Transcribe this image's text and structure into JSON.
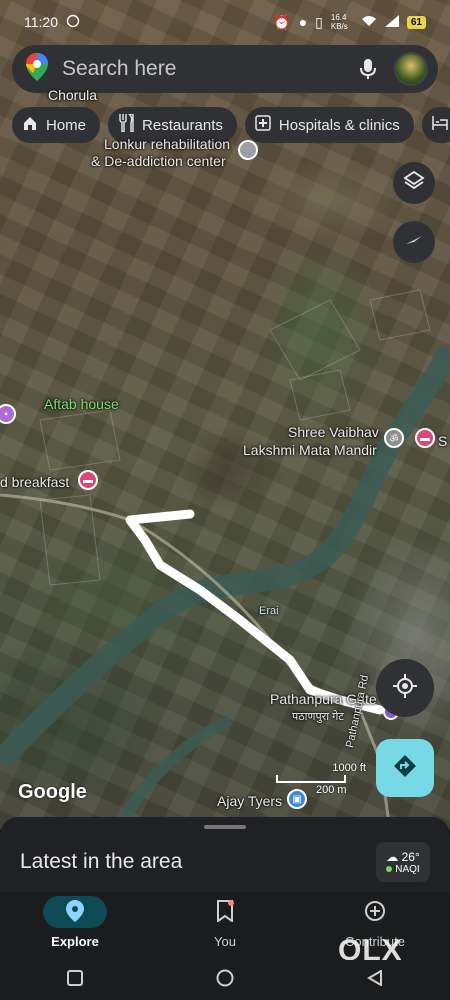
{
  "status_bar": {
    "time": "11:20",
    "speed": "16.4 KB/s",
    "battery": "61"
  },
  "search": {
    "placeholder": "Search here"
  },
  "chips": [
    {
      "icon": "home-icon",
      "label": "Home"
    },
    {
      "icon": "restaurant-icon",
      "label": "Restaurants"
    },
    {
      "icon": "hospital-icon",
      "label": "Hospitals & clinics"
    },
    {
      "icon": "hotel-icon",
      "label": ""
    }
  ],
  "map": {
    "labels": {
      "top_partial": "Chorula",
      "rehab_line1": "Lonkur rehabilitation",
      "rehab_line2": "& De-addiction center",
      "aftab": "Aftab house",
      "temple_line1": "Shree Vaibhav",
      "temple_line2": "Lakshmi Mata Mandir",
      "temple_right": "S",
      "breakfast": "d breakfast",
      "river": "Erai",
      "pathanpura": "Pathanpura Gate",
      "pathanpura_hindi": "पठाणपुरा गेट",
      "road": "Pathanpura Rd",
      "ajay": "Ajay Tyers"
    },
    "scale": {
      "feet": "1000 ft",
      "meters": "200 m"
    },
    "logo": "Google"
  },
  "sheet": {
    "title": "Latest in the area",
    "temperature": "26°",
    "aqi": "NAQI"
  },
  "nav": [
    {
      "icon": "explore-icon",
      "label": "Explore",
      "active": true
    },
    {
      "icon": "you-icon",
      "label": "You",
      "active": false
    },
    {
      "icon": "contribute-icon",
      "label": "Contribute",
      "active": false
    }
  ],
  "watermark": "OLX",
  "colors": {
    "accent_directions": "#78d9e6",
    "nav_active": "#0e4a55",
    "route_drawn": "#ffffff"
  }
}
